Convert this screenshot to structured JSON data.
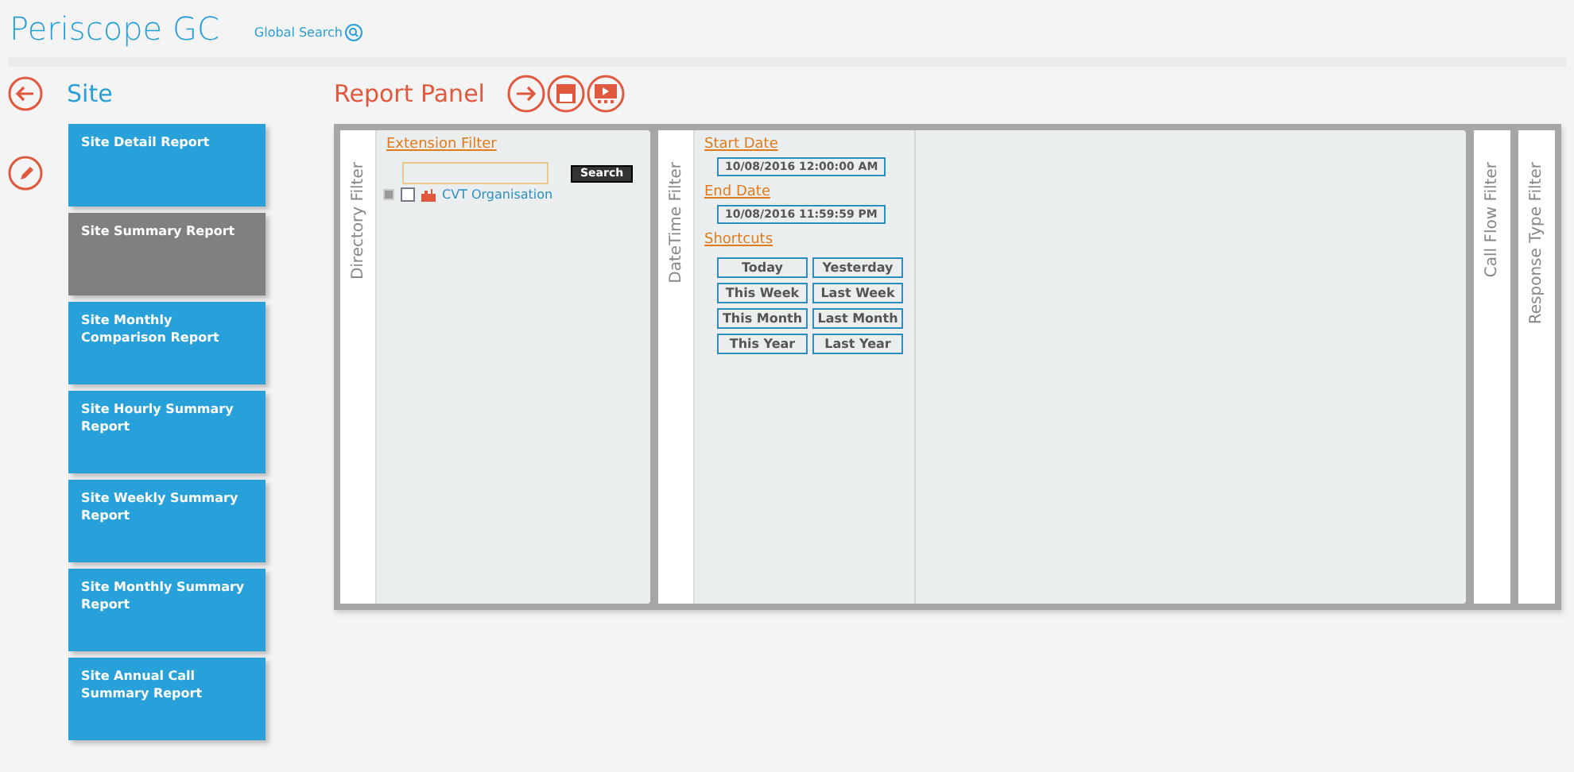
{
  "app": {
    "title": "Periscope GC",
    "global_search": "Global Search"
  },
  "site": {
    "title": "Site"
  },
  "reports": [
    {
      "label": "Site Detail Report",
      "selected": false
    },
    {
      "label": "Site Summary Report",
      "selected": true
    },
    {
      "label": "Site Monthly Comparison Report",
      "selected": false
    },
    {
      "label": "Site Hourly Summary Report",
      "selected": false
    },
    {
      "label": "Site Weekly Summary Report",
      "selected": false
    },
    {
      "label": "Site Monthly Summary Report",
      "selected": false
    },
    {
      "label": "Site Annual Call Summary Report",
      "selected": false
    }
  ],
  "report_panel": {
    "title": "Report Panel",
    "directory_filter": {
      "tab": "Directory Filter",
      "heading": "Extension Filter",
      "search_button": "Search",
      "tree": [
        {
          "label": "CVT Organisation",
          "checked": false,
          "expanded": false
        }
      ]
    },
    "datetime_filter": {
      "tab": "DateTime Filter",
      "start_label": "Start Date",
      "start_value": "10/08/2016 12:00:00 AM",
      "end_label": "End Date",
      "end_value": "10/08/2016 11:59:59 PM",
      "shortcuts_label": "Shortcuts",
      "shortcuts": [
        "Today",
        "Yesterday",
        "This Week",
        "Last Week",
        "This Month",
        "Last Month",
        "This Year",
        "Last Year"
      ]
    },
    "collapsed_tabs": [
      "Call Flow Filter",
      "Response Type Filter"
    ]
  }
}
